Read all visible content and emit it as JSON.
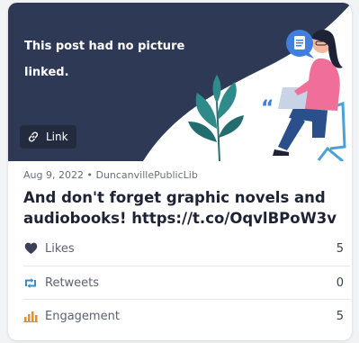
{
  "post": {
    "placeholder_text": "This post had no picture linked.",
    "link_label": "Link",
    "date": "Aug 9, 2022",
    "separator": "•",
    "author": "DuncanvillePublicLib",
    "text": "And don't forget graphic novels and audiobooks! https://t.co/OqvlBPoW3v"
  },
  "stats": [
    {
      "label": "Likes",
      "value": "5",
      "icon": "heart-icon",
      "color": "#3a3e58"
    },
    {
      "label": "Retweets",
      "value": "0",
      "icon": "retweet-icon",
      "color": "#3b8ec4"
    },
    {
      "label": "Engagement",
      "value": "5",
      "icon": "bar-chart-icon",
      "color": "#f08a24"
    }
  ],
  "colors": {
    "hero_bg": "#2e3a55",
    "accent_blue": "#3f7fe0",
    "accent_pink": "#ef6f9a"
  }
}
